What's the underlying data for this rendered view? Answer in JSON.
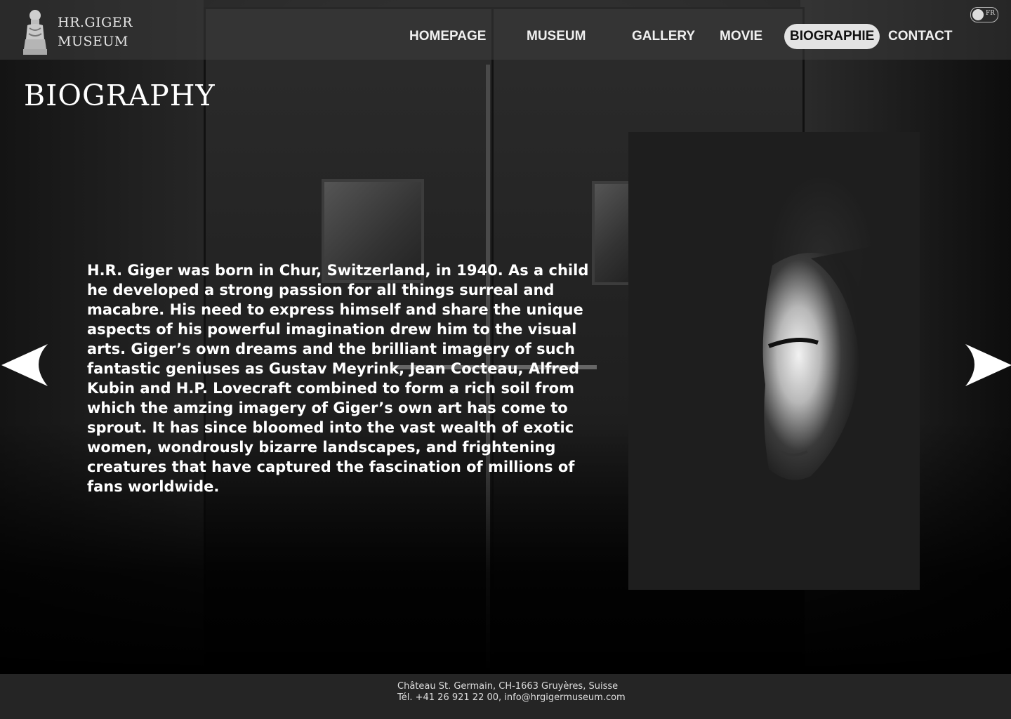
{
  "brand": {
    "line1": "HR.GIGER",
    "line2": "MUSEUM"
  },
  "nav": [
    {
      "label": "HOMEPAGE",
      "active": false
    },
    {
      "label": "MUSEUM",
      "active": false
    },
    {
      "label": "GALLERY",
      "active": false
    },
    {
      "label": "MOVIE",
      "active": false
    },
    {
      "label": "BIOGRAPHIE",
      "active": true
    },
    {
      "label": "CONTACT",
      "active": false
    }
  ],
  "language_toggle": {
    "label": "FR"
  },
  "page_title": "BIOGRAPHY",
  "bio_text": "H.R. Giger was born in Chur, Switzerland, in 1940. As a child he developed a strong passion for all things surreal and macabre. His need to express himself and share the unique aspects of his powerful imagination drew him to the visual arts. Giger’s own dreams and the brilliant imagery of such fantastic geniuses as Gustav Meyrink, Jean Cocteau, Alfred Kubin and H.P. Lovecraft combined to form a rich soil from which the amzing imagery of Giger’s own art has come to sprout. It has since bloomed into the vast wealth of exotic women, wondrously bizarre landscapes, and frightening creatures that have captured the fascination of millions of fans worldwide.",
  "footer": {
    "address": "Château St. Germain, CH-1663 Gruyères, Suisse",
    "contact": "Tél. +41 26 921 22 00, info@hrgigermuseum.com"
  },
  "icons": {
    "logo": "biomechanical-statue-icon",
    "prev": "arrow-left-icon",
    "next": "arrow-right-icon"
  },
  "colors": {
    "header_bg": "#3c3c3c",
    "active_nav_bg": "#e3e3e3",
    "footer_bg": "#252525",
    "portrait_bg": "#1e1e1e"
  }
}
